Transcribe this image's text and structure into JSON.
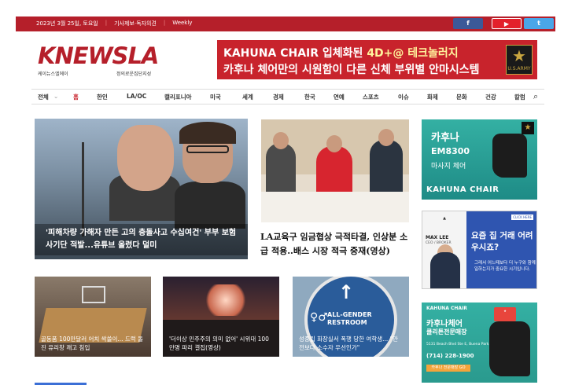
{
  "topbar": {
    "date": "2023년 3월 25일, 토요일",
    "link1": "기사제보·독자의견",
    "link2": "Weekly",
    "facebook": "f",
    "youtube": "▶",
    "twitter": "t"
  },
  "logo": {
    "brand_k": "K",
    "brand_news": "NEWS",
    "brand_la": "LA",
    "sub_left": "케이뉴스엘에이",
    "sub_right": "정의로운집단지성"
  },
  "banner": {
    "line1_a": "KAHUNA ",
    "line1_b": "CHAIR",
    "line1_c": " 입체화된 ",
    "line1_d": "4D+@ 테크놀러지",
    "line2": "카후나 체어만의 시원함이 다른 신체 부위별 안마시스템",
    "army": "U.S.ARMY"
  },
  "nav": {
    "items": [
      "전체",
      "홈",
      "한인",
      "LA/OC",
      "캘리포니아",
      "미국",
      "세계",
      "경제",
      "한국",
      "연예",
      "스포츠",
      "이슈",
      "화제",
      "문화",
      "건강",
      "칼럼"
    ]
  },
  "stories": {
    "big_caption": "'피해차량 가해자 만든 고의 충돌사고 수십여건' 부부 보험사기단 적발...유튜브 올렸다 덜미",
    "mid_title": "LA교육구 임금협상 극적타결, 인상분 소급 적용..배스 시장 적극 중재(영상)",
    "b1_caption": "골동품 100만달러 어치 싹쓸이... 드럭 돌진 유리창 깨고 침입",
    "b2_caption": "'더이상 민주주의 의미 없어' 시위대 100만명 파리 결집(영상)",
    "b3_caption": "성중립 화장실서 폭행 당한 여학생... \"안전보다 소수자 우선인가\""
  },
  "ads": {
    "ad1": {
      "t1": "카후나",
      "t2": "EM8300",
      "t3": "마사지 체어",
      "brand": "KAHUNA CHAIR"
    },
    "ad2": {
      "name": "MAX LEE",
      "role": "CEO / BROKER",
      "q": "요즘 집 거래 어려우시죠?",
      "q2": "그래서 어느때보다 더 누구와 함께 일하는지가 중요한 시기입니다.",
      "click": "CLICK HERE"
    },
    "ad3": {
      "t1": "KAHUNA CHAIR",
      "t2": "카후나체어",
      "t3": "클리튼전문매장",
      "addr": "5131 Beach Blvd Ste E, Buena Park, CA 90621",
      "phone": "(714) 228-1900",
      "btn": "카후나 전문매장 GO"
    }
  },
  "colors": {
    "brand_red": "#b51f2a",
    "banner_red": "#c8232c",
    "teal": "#34b0a3",
    "blue": "#2f55b0"
  }
}
